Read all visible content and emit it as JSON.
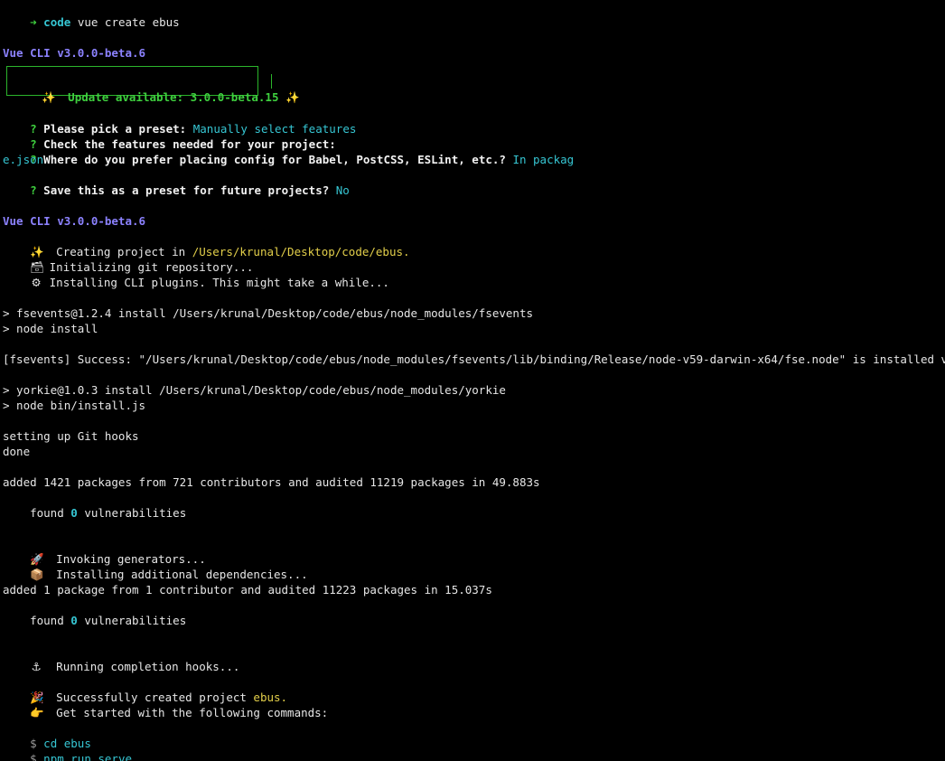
{
  "terminal": {
    "command_line": {
      "arrow": "➜",
      "directory": "code",
      "command": "vue create ebus"
    },
    "vue_cli_header_1": "Vue CLI v3.0.0-beta.6",
    "update_notice": {
      "sparkle_left": "✨",
      "text": "Update available: 3.0.0-beta.15",
      "sparkle_right": "✨"
    },
    "prompts": [
      {
        "mark": "?",
        "question": "Please pick a preset:",
        "answer": "Manually select features"
      },
      {
        "mark": "?",
        "question": "Check the features needed for your project:",
        "answer": ""
      },
      {
        "mark": "?",
        "question": "Where do you prefer placing config for Babel, PostCSS, ESLint, etc.?",
        "answer": "In packag"
      },
      {
        "mark": "",
        "question": "",
        "answer": "e.json"
      },
      {
        "mark": "?",
        "question": "Save this as a preset for future projects?",
        "answer": "No"
      }
    ],
    "vue_cli_header_2": "Vue CLI v3.0.0-beta.6",
    "creating": {
      "icon": "✨",
      "text": "Creating project in",
      "path": "/Users/krunal/Desktop/code/ebus."
    },
    "init_git": {
      "icon": "🗃",
      "text": "Initializing git repository..."
    },
    "install_plugins": {
      "icon": "⚙",
      "text": "Installing CLI plugins. This might take a while..."
    },
    "fsevents_install": "> fsevents@1.2.4 install /Users/krunal/Desktop/code/ebus/node_modules/fsevents",
    "fsevents_node": "> node install",
    "fsevents_success": "[fsevents] Success: \"/Users/krunal/Desktop/code/ebus/node_modules/fsevents/lib/binding/Release/node-v59-darwin-x64/fse.node\" is installed via remote",
    "yorkie_install": "> yorkie@1.0.3 install /Users/krunal/Desktop/code/ebus/node_modules/yorkie",
    "yorkie_node": "> node bin/install.js",
    "git_hooks": "setting up Git hooks",
    "done": "done",
    "added_packages_1": "added 1421 packages from 721 contributors and audited 11219 packages in 49.883s",
    "found_1": {
      "prefix": "found",
      "count": "0",
      "suffix": "vulnerabilities"
    },
    "invoking": {
      "icon": "🚀",
      "text": "Invoking generators..."
    },
    "installing_deps": {
      "icon": "📦",
      "text": "Installing additional dependencies..."
    },
    "added_packages_2": "added 1 package from 1 contributor and audited 11223 packages in 15.037s",
    "found_2": {
      "prefix": "found",
      "count": "0",
      "suffix": "vulnerabilities"
    },
    "completion_hooks": {
      "icon": "⚓",
      "text": "Running completion hooks..."
    },
    "success": {
      "icon": "🎉",
      "text": "Successfully created project",
      "name": "ebus."
    },
    "get_started": {
      "icon": "👉",
      "text": "Get started with the following commands:"
    },
    "commands": [
      {
        "dollar": "$",
        "cmd": "cd ebus"
      },
      {
        "dollar": "$",
        "cmd": "npm run serve"
      }
    ]
  },
  "colors": {
    "background": "#000000",
    "text": "#e6e6e6",
    "green": "#3fd13f",
    "cyan": "#36c6d3",
    "purple": "#8c82ff",
    "yellow": "#e3cf4a"
  }
}
